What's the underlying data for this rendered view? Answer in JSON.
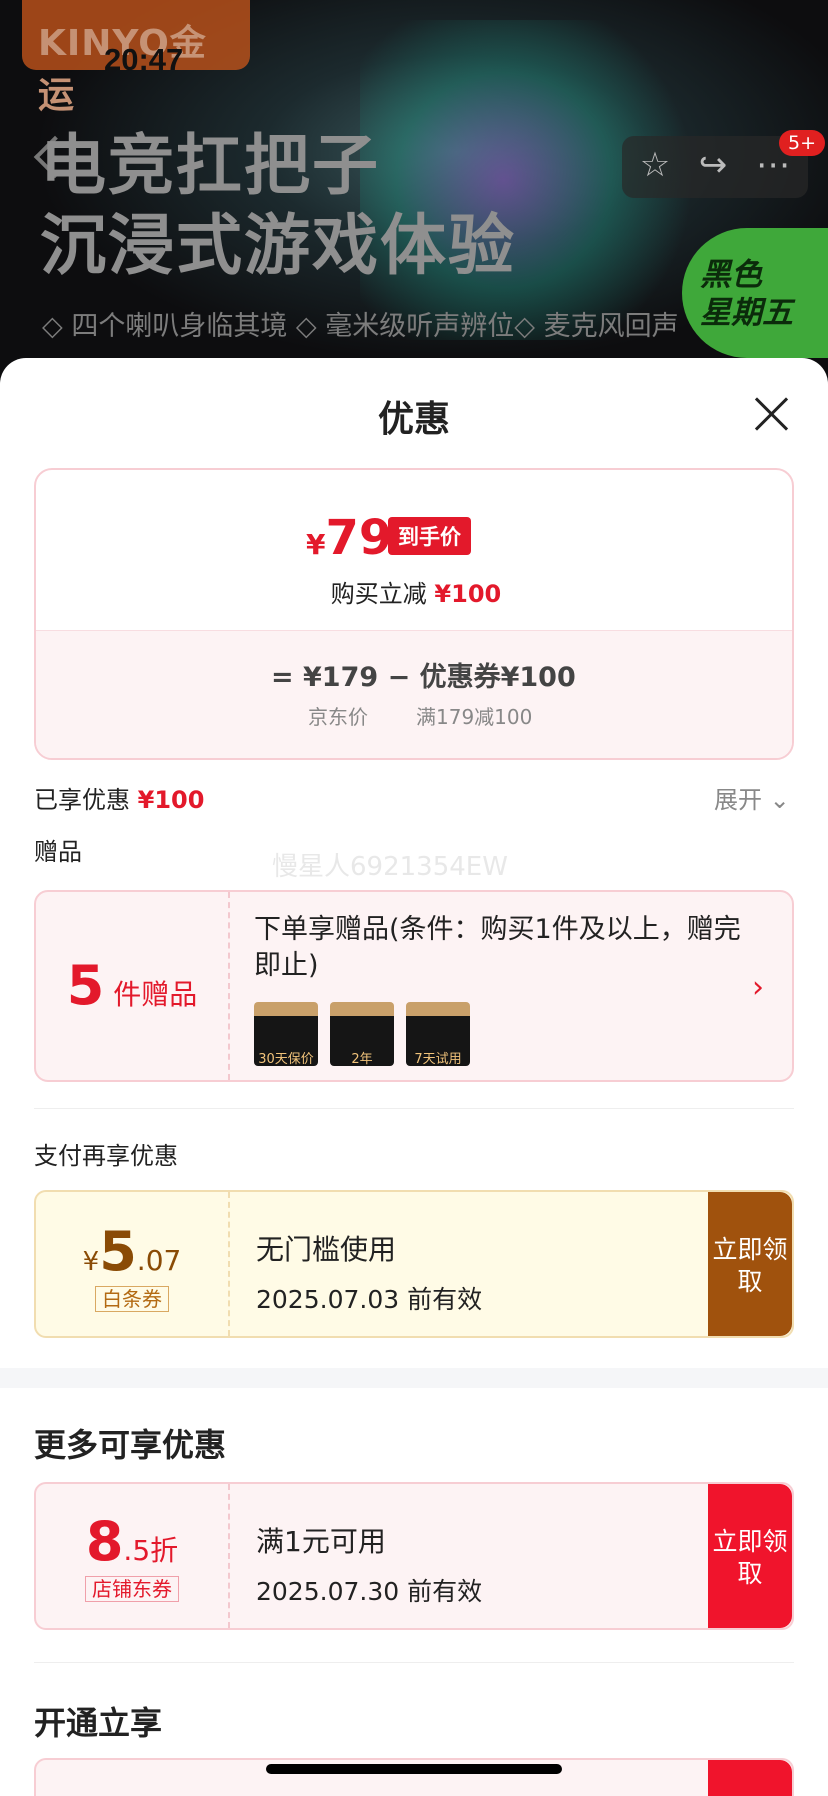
{
  "bg": {
    "logo": "KINYO金运",
    "time": "20:47",
    "hero_line1": "电竞扛把子",
    "hero_line2": "沉浸式游戏体验",
    "subtitle": "◇ 四个喇叭身临其境 ◇ 毫米级听声辨位◇ 麦克风回声",
    "badge": "5+",
    "promo_line1": "黑色",
    "promo_line2": "星期五"
  },
  "sheet": {
    "title": "优惠"
  },
  "price": {
    "currency": "¥",
    "final": "79",
    "final_tag": "到手价",
    "reduce_label": "购买立减",
    "reduce_value": "¥100",
    "formula": "= ¥179 − 优惠券¥100",
    "jd_price_label": "京东价",
    "coupon_label": "满179减100"
  },
  "enjoyed": {
    "label": "已享优惠",
    "value": "¥100",
    "expand": "展开"
  },
  "gifts": {
    "section": "赠品",
    "watermark": "慢星人6921354EW",
    "count": "5",
    "count_unit": "件赠品",
    "desc": "下单享赠品(条件：购买1件及以上，赠完即止)",
    "thumbs": [
      "30天保价",
      "2年",
      "7天试用"
    ]
  },
  "pay": {
    "section": "支付再享优惠",
    "currency": "¥",
    "amount": "5",
    "decimal": ".07",
    "kind": "白条券",
    "name": "无门槛使用",
    "valid": "2025.07.03 前有效",
    "button": "立即领取"
  },
  "more": {
    "section": "更多可享优惠",
    "amount": "8",
    "decimal": ".5",
    "unit": "折",
    "kind": "店铺东券",
    "name": "满1元可用",
    "valid": "2025.07.30 前有效",
    "button": "立即领取"
  },
  "open": {
    "section": "开通立享"
  }
}
